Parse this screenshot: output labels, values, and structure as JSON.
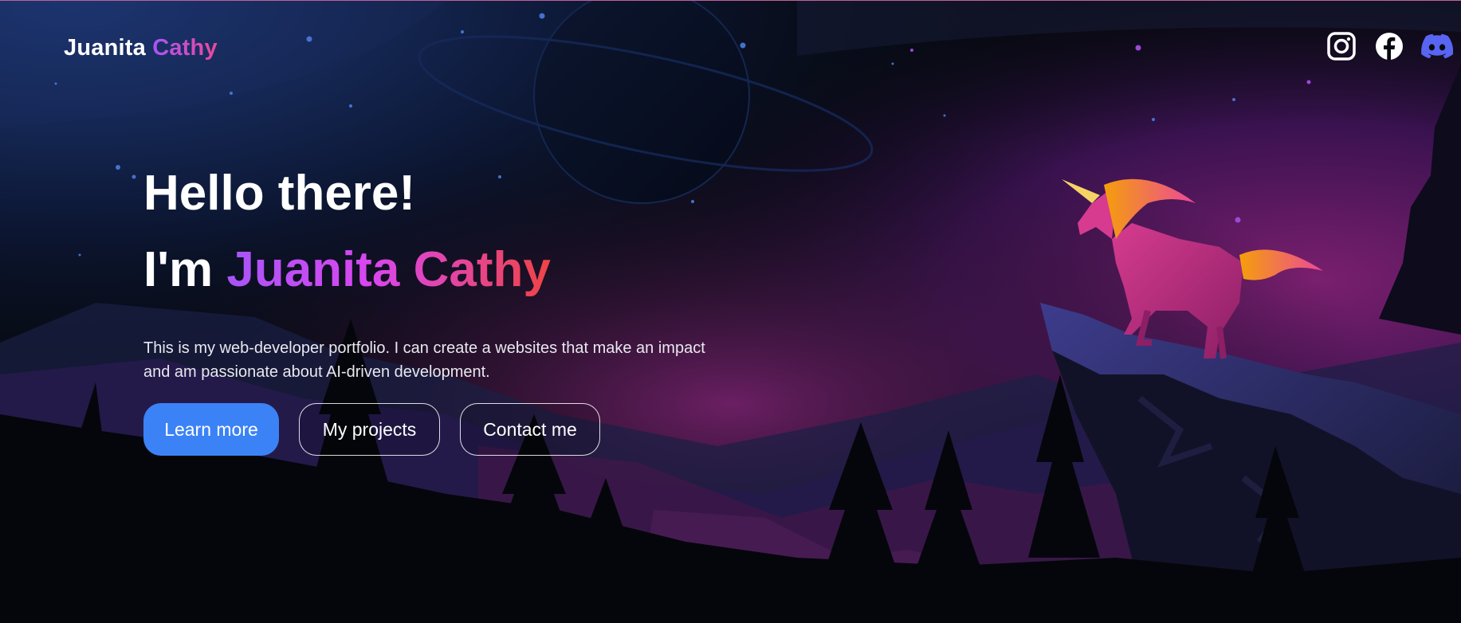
{
  "header": {
    "logo_first": "Juanita",
    "logo_second": "Cathy",
    "social": [
      {
        "name": "instagram",
        "icon": "instagram-icon"
      },
      {
        "name": "facebook",
        "icon": "facebook-icon"
      },
      {
        "name": "discord",
        "icon": "discord-icon"
      }
    ]
  },
  "hero": {
    "greeting": "Hello there!",
    "intro_prefix": "I'm",
    "intro_name": "Juanita Cathy",
    "description": "This is my web-developer portfolio. I can create a websites that make an impact and am passionate about AI-driven development.",
    "buttons": {
      "learn_more": "Learn more",
      "projects": "My projects",
      "contact": "Contact me"
    }
  },
  "colors": {
    "accent_blue": "#3b82f6",
    "gradient_start": "#a855f7",
    "gradient_end": "#ef4444",
    "discord": "#5865f2"
  }
}
